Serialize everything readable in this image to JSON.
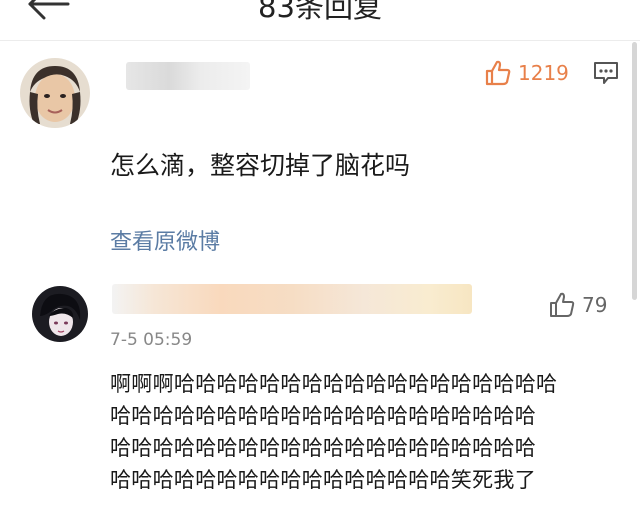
{
  "header": {
    "title": "83条回复"
  },
  "comments": [
    {
      "text": "怎么滴，整容切掉了脑花吗",
      "link": "查看原微博",
      "likes": "1219",
      "like_color": "#e8804a"
    },
    {
      "time": "7-5 05:59",
      "likes": "79",
      "lines": [
        "啊啊啊哈哈哈哈哈哈哈哈哈哈哈哈哈哈哈哈哈哈",
        "哈哈哈哈哈哈哈哈哈哈哈哈哈哈哈哈哈哈哈哈",
        "哈哈哈哈哈哈哈哈哈哈哈哈哈哈哈哈哈哈哈哈",
        "哈哈哈哈哈哈哈哈哈哈哈哈哈哈哈哈笑死我了"
      ]
    }
  ],
  "icons": {
    "back": "back-arrow-icon",
    "like": "thumbs-up-icon",
    "reply": "reply-bubble-icon"
  }
}
